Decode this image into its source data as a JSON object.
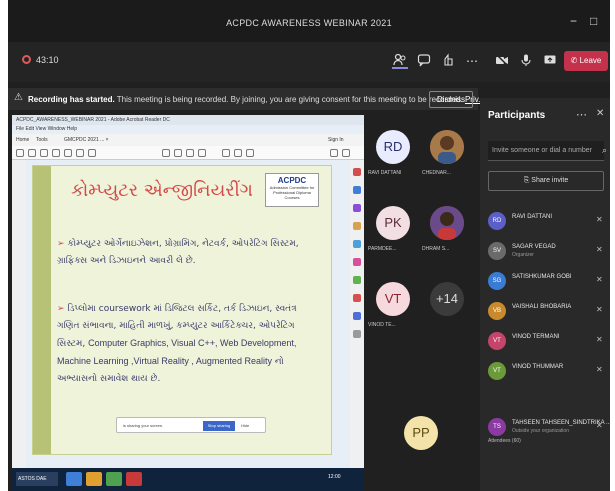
{
  "window": {
    "title": "ACPDC AWARENESS WEBINAR 2021",
    "minimize": "−",
    "maximize": "□"
  },
  "toolbar": {
    "timer": "43:10",
    "leave_label": "Leave"
  },
  "banner": {
    "bold": "Recording has started.",
    "text": "This meeting is being recorded. By joining, you are giving consent for this meeting to be recorded.",
    "link": "Priv...",
    "dismiss": "Dismiss"
  },
  "shared_screen": {
    "app_title": "ACPDC_AWARENESS_WEBINAR 2021 - Adobe Acrobat Reader DC",
    "menu": "File  Edit  View  Window  Help",
    "tab_home": "Home",
    "tab_tools": "Tools",
    "tab_doc": "GMCPDC 2021 ... ×",
    "sign_in": "Sign In",
    "slide": {
      "title": "કોમ્પ્યુટર એન્જીનિયરીંગ",
      "logo_name": "ACPDC",
      "logo_sub": "Admission Committee for Professional Diploma Courses",
      "bullet1": "કોમ્પ્યુટર ઓર્ગેનાઇઝેશન, પ્રોગ્રામિંગ, નેટવર્ક, ઓપરેટિંગ સિસ્ટમ, ગ્રાફિક્સ અને ડિઝાઇનને આવરી લે છે.",
      "bullet2": "ડિપ્લોમા coursework માં ડિજિટલ સર્કિટ, તર્ક ડિઝાઇન, સ્વતંત્ર ગણિત સંભાવના, માહિતી માળખું, કમ્પ્યુટર આર્કિટેક્ચર, ઓપરેટિંગ સિસ્ટમ,",
      "bullet2_latin": "Computer Graphics, Visual C++, Web Development, Machine Learning ,Virtual Reality , Augmented Reality",
      "bullet2_end": "નો અભ્યાસનો સમાવેશ થાય છે."
    },
    "share_pill": {
      "text": "is sharing your screen.",
      "stop": "Stop sharing",
      "hide": "Hide"
    },
    "taskbar": {
      "start": "ASTOS DAE",
      "clock": "12:00"
    }
  },
  "video_grid": [
    {
      "initials": "RD",
      "name": "RAVI DATTANI",
      "color": "#e9ecff",
      "text_color": "#2b2f6b"
    },
    {
      "initials": "",
      "name": "CHEDNAR... ",
      "photo": true
    },
    {
      "initials": "PK",
      "name": "PARMDEE... ",
      "color": "#f1dfe3",
      "text_color": "#5a2c38"
    },
    {
      "initials": "",
      "name": "DHRAM S... ",
      "photo": true
    },
    {
      "initials": "VT",
      "name": "VINOD TE... ",
      "color": "#f6d9dd",
      "text_color": "#8b2432"
    },
    {
      "initials": "+14",
      "name": "",
      "color": "#3b3b3b",
      "text_color": "#dddddd"
    },
    {
      "initials": "PP",
      "name": "",
      "color": "#f4e3a9",
      "text_color": "#5b4a13"
    }
  ],
  "participants": {
    "title": "Participants",
    "invite_placeholder": "Invite someone or dial a number",
    "share_invite": "Share invite",
    "people": [
      {
        "name": "RAVI DATTANI",
        "role": "",
        "color": "#5b5fc7",
        "initials": "RD"
      },
      {
        "name": "SAGAR VEGAD",
        "role": "Organizer",
        "color": "#6a6a6a",
        "initials": "SV"
      },
      {
        "name": "SATISHKUMAR GOBI",
        "role": "",
        "color": "#3a7bd5",
        "initials": "SG"
      },
      {
        "name": "VAISHALI BHOBARIA",
        "role": "",
        "color": "#c98a2b",
        "initials": "VB"
      },
      {
        "name": "VINOD TERMANI",
        "role": "",
        "color": "#c44569",
        "initials": "VT"
      },
      {
        "name": "VINOD THUMMAR",
        "role": "",
        "color": "#6a9a3a",
        "initials": "VT"
      },
      {
        "name": "TAHSEEN TAHSEEN_SINDTRIKA ...",
        "role": "Outside your organization",
        "color": "#8a3aa0",
        "initials": "TS"
      }
    ],
    "attendees_label": "Attendees (60)"
  }
}
